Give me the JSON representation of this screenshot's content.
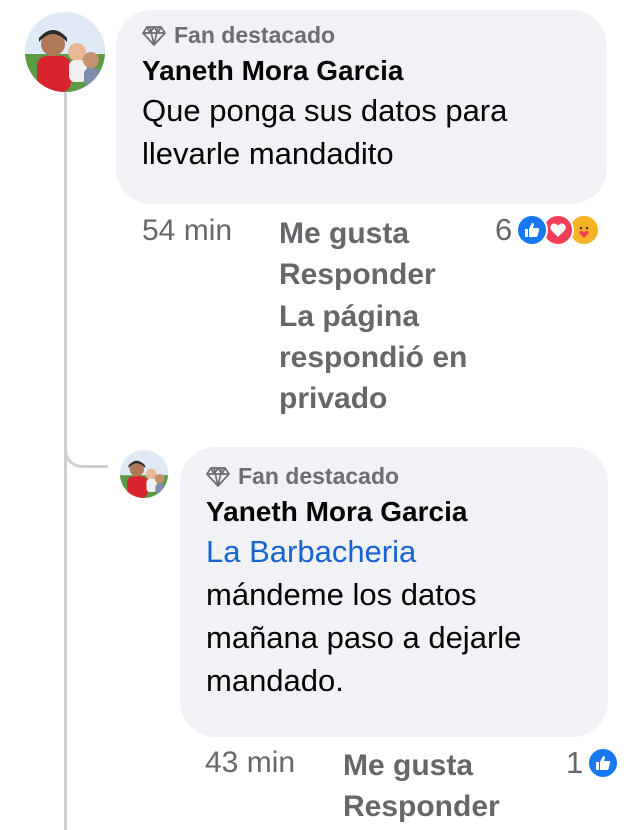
{
  "comment1": {
    "badge": "Fan destacado",
    "author": "Yaneth Mora Garcia",
    "text_line1": "Que ponga sus datos para",
    "text_line2": "llevarle mandadito",
    "time": "54 min",
    "like_label": "Me gusta",
    "reply_label": "Responder",
    "page_reply_line1": "La página",
    "page_reply_line2": "respondió en",
    "page_reply_line3": "privado",
    "reaction_count": "6",
    "reaction_icons": [
      "like-icon",
      "love-icon",
      "care-icon"
    ]
  },
  "comment2": {
    "badge": "Fan destacado",
    "author": "Yaneth Mora Garcia",
    "mention": "La Barbacheria",
    "text_line1": "mándeme los datos",
    "text_line2": "mañana paso a dejarle",
    "text_line3": "mandado.",
    "time": "43 min",
    "like_label": "Me gusta",
    "reply_label": "Responder",
    "reaction_count": "1",
    "reaction_icons": [
      "like-icon"
    ]
  },
  "colors": {
    "bubble": "#f0f2f5",
    "muted_text": "#65676b",
    "mention_blue": "#1763cf",
    "like_blue": "#1877f2",
    "love_red": "#f33e58",
    "care_yellow": "#f7b125"
  }
}
